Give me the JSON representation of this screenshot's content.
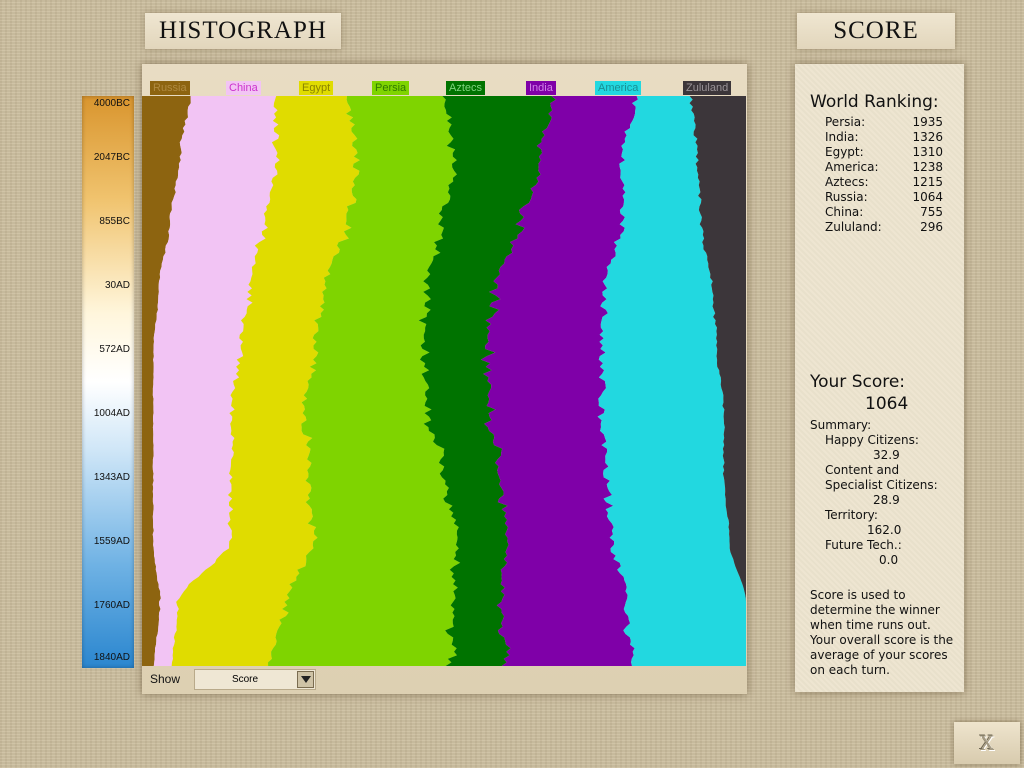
{
  "histograph_title": "HISTOGRAPH",
  "score_title": "SCORE",
  "timeline_ticks": [
    "4000BC",
    "2047BC",
    "855BC",
    "30AD",
    "572AD",
    "1004AD",
    "1343AD",
    "1559AD",
    "1760AD",
    "1840AD"
  ],
  "civilizations": [
    {
      "name": "Russia",
      "color": "#8d6410",
      "label_fg": "#b08a40",
      "label_bg": "#8d6410"
    },
    {
      "name": "China",
      "color": "#f2c4f4",
      "label_fg": "#cc33cc",
      "label_bg": "#f2c4f4"
    },
    {
      "name": "Egypt",
      "color": "#e0dc00",
      "label_fg": "#8a8400",
      "label_bg": "#e0dc00"
    },
    {
      "name": "Persia",
      "color": "#7fd400",
      "label_fg": "#2f7a00",
      "label_bg": "#7fd400"
    },
    {
      "name": "Aztecs",
      "color": "#007300",
      "label_fg": "#7fd47f",
      "label_bg": "#007300"
    },
    {
      "name": "India",
      "color": "#7f00a8",
      "label_fg": "#d07fe8",
      "label_bg": "#7f00a8"
    },
    {
      "name": "America",
      "color": "#22d8e0",
      "label_fg": "#1a8f94",
      "label_bg": "#22d8e0"
    },
    {
      "name": "Zululand",
      "color": "#3c363a",
      "label_fg": "#9a9397",
      "label_bg": "#3c363a"
    }
  ],
  "world_ranking": {
    "heading": "World Ranking:",
    "entries": [
      {
        "name": "Persia:",
        "score": "1935"
      },
      {
        "name": "India:",
        "score": "1326"
      },
      {
        "name": "Egypt:",
        "score": "1310"
      },
      {
        "name": "America:",
        "score": "1238"
      },
      {
        "name": "Aztecs:",
        "score": "1215"
      },
      {
        "name": "Russia:",
        "score": "1064"
      },
      {
        "name": "China:",
        "score": "755"
      },
      {
        "name": "Zululand:",
        "score": "296"
      }
    ]
  },
  "your_score": {
    "heading": "Your Score:",
    "value": "1064",
    "summary_label": "Summary:",
    "happy_label": "Happy Citizens:",
    "happy_value": "32.9",
    "content_label_1": "Content and",
    "content_label_2": "Specialist Citizens:",
    "content_value": "28.9",
    "territory_label": "Territory:",
    "territory_value": "162.0",
    "future_label": "Future Tech.:",
    "future_value": "0.0",
    "note": "Score is used to determine the winner when time runs out. Your overall score is the average of your scores on each turn."
  },
  "controls": {
    "show_label": "Show",
    "show_value": "Score",
    "close_label": "X"
  },
  "chart_data": {
    "type": "area",
    "stacking": "percent",
    "x": [
      "4000BC",
      "2047BC",
      "855BC",
      "30AD",
      "572AD",
      "1004AD",
      "1343AD",
      "1559AD",
      "1760AD",
      "1840AD"
    ],
    "series": [
      {
        "name": "Russia",
        "values": [
          8,
          7,
          5,
          3,
          2,
          2,
          2,
          2,
          3,
          2
        ]
      },
      {
        "name": "China",
        "values": [
          14,
          18,
          17,
          16,
          15,
          14,
          14,
          14,
          3,
          3
        ]
      },
      {
        "name": "Egypt",
        "values": [
          12,
          15,
          15,
          13,
          13,
          13,
          14,
          15,
          18,
          16
        ]
      },
      {
        "name": "Persia",
        "values": [
          16,
          18,
          17,
          18,
          19,
          22,
          24,
          26,
          28,
          30
        ]
      },
      {
        "name": "Aztecs",
        "values": [
          18,
          16,
          14,
          12,
          11,
          11,
          10,
          9,
          8,
          9
        ]
      },
      {
        "name": "India",
        "values": [
          14,
          15,
          18,
          19,
          20,
          20,
          19,
          19,
          21,
          21
        ]
      },
      {
        "name": "America",
        "values": [
          9,
          14,
          14,
          19,
          20,
          22,
          21,
          21,
          20,
          19
        ]
      },
      {
        "name": "Zululand",
        "values": [
          9,
          9,
          8,
          6,
          5,
          4,
          4,
          3,
          0,
          0
        ]
      }
    ]
  }
}
